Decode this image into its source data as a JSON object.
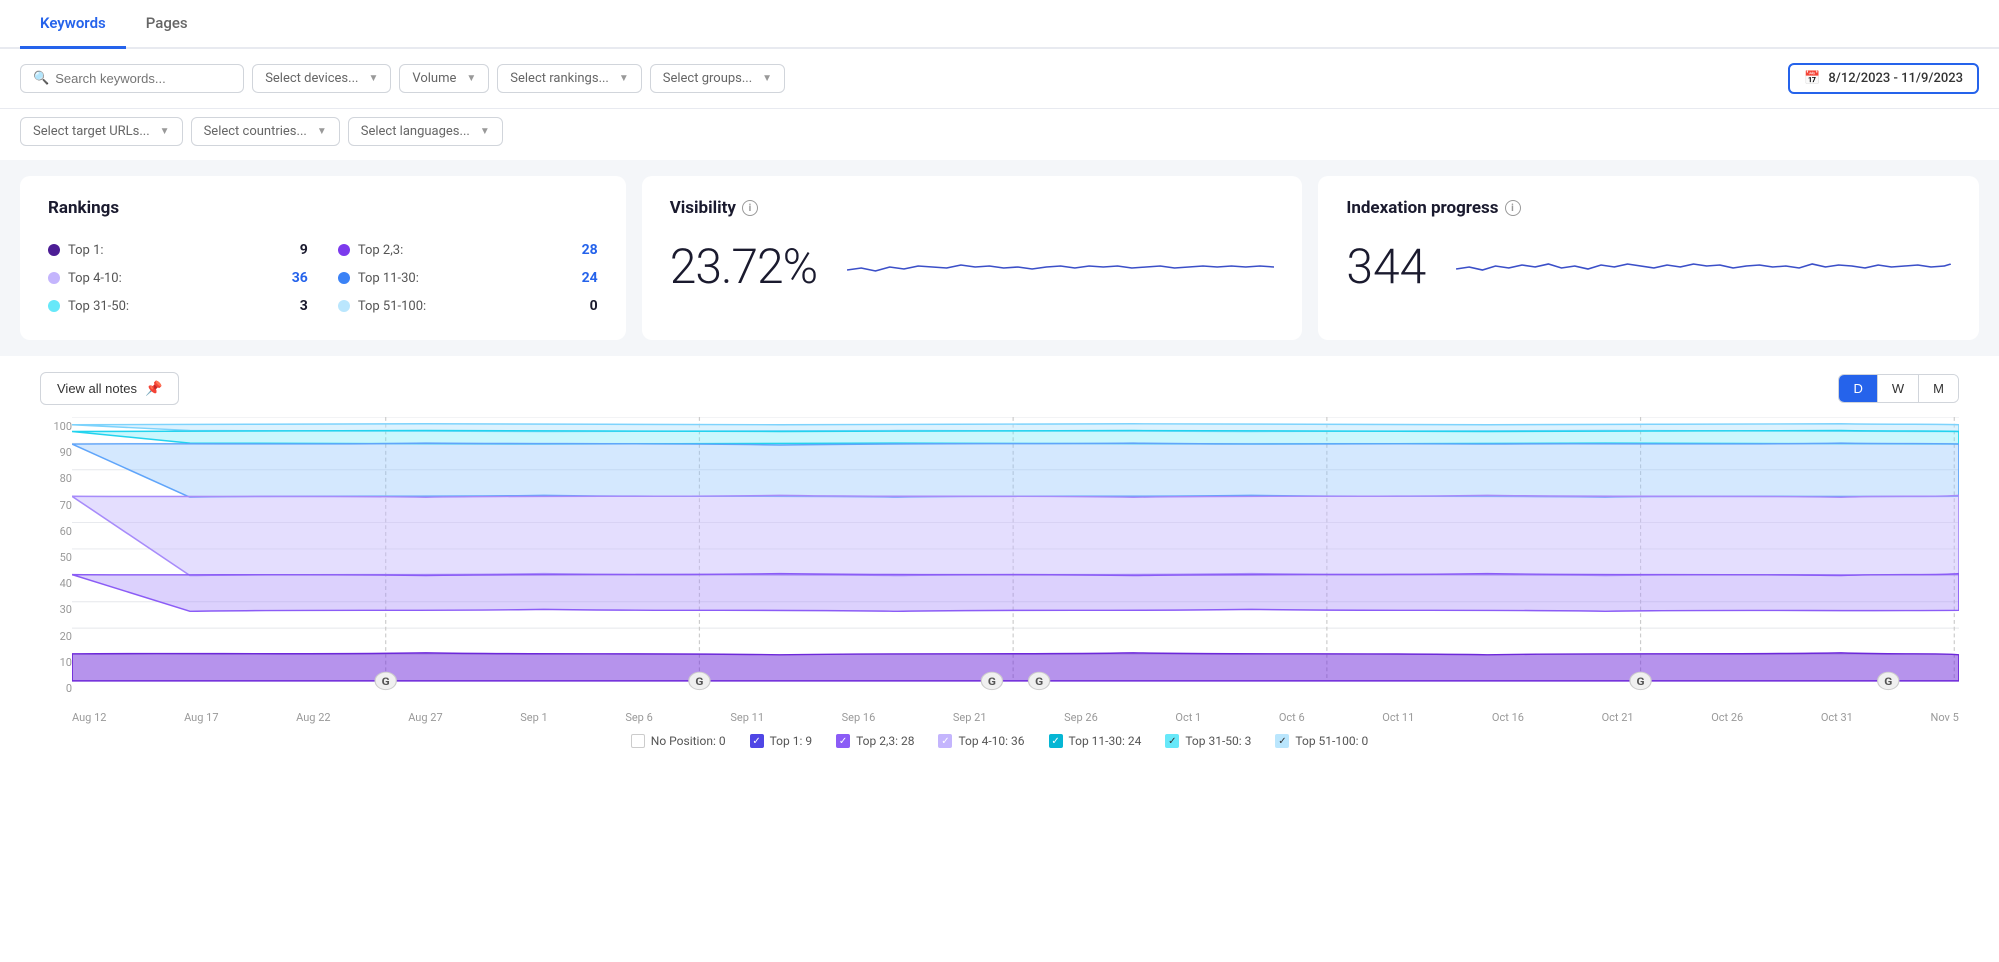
{
  "tabs": [
    {
      "label": "Keywords",
      "active": true
    },
    {
      "label": "Pages",
      "active": false
    }
  ],
  "filters": {
    "search_placeholder": "Search keywords...",
    "devices_placeholder": "Select devices...",
    "volume_placeholder": "Volume",
    "rankings_placeholder": "Select rankings...",
    "groups_placeholder": "Select groups...",
    "date_range": "8/12/2023 - 11/9/2023",
    "target_urls_placeholder": "Select target URLs...",
    "countries_placeholder": "Select countries...",
    "languages_placeholder": "Select languages..."
  },
  "rankings": {
    "title": "Rankings",
    "items": [
      {
        "label": "Top 1:",
        "value": "9",
        "color": "#5b21b6"
      },
      {
        "label": "Top 2,3:",
        "value": "28",
        "color": "#7c3aed"
      },
      {
        "label": "Top 4-10:",
        "value": "36",
        "color": "#c4b5fd"
      },
      {
        "label": "Top 11-30:",
        "value": "24",
        "color": "#3b82f6"
      },
      {
        "label": "Top 31-50:",
        "value": "3",
        "color": "#67e8f9"
      },
      {
        "label": "Top 51-100:",
        "value": "0",
        "color": "#bae6fd"
      }
    ]
  },
  "visibility": {
    "title": "Visibility",
    "value": "23.72%"
  },
  "indexation": {
    "title": "Indexation progress",
    "value": "344"
  },
  "chart": {
    "view_notes_label": "View all notes",
    "period_buttons": [
      "D",
      "W",
      "M"
    ],
    "active_period": "D",
    "y_labels": [
      "100",
      "90",
      "80",
      "70",
      "60",
      "50",
      "40",
      "30",
      "20",
      "10",
      "0"
    ],
    "x_labels": [
      "Aug 12",
      "Aug 17",
      "Aug 22",
      "Aug 27",
      "Sep 1",
      "Sep 6",
      "Sep 11",
      "Sep 16",
      "Sep 21",
      "Sep 26",
      "Oct 1",
      "Oct 6",
      "Oct 11",
      "Oct 16",
      "Oct 21",
      "Oct 26",
      "Oct 31",
      "Nov 5"
    ]
  },
  "legend": [
    {
      "label": "No Position: 0",
      "color": "none",
      "checked": false,
      "border": "#ccc"
    },
    {
      "label": "Top 1: 9",
      "color": "#4f46e5",
      "checked": true
    },
    {
      "label": "Top 2,3: 28",
      "color": "#8b5cf6",
      "checked": true
    },
    {
      "label": "Top 4-10: 36",
      "color": "#c4b5fd",
      "checked": true
    },
    {
      "label": "Top 11-30: 24",
      "color": "#06b6d4",
      "checked": true
    },
    {
      "label": "Top 31-50: 3",
      "color": "#67e8f9",
      "checked": true
    },
    {
      "label": "Top 51-100: 0",
      "color": "#bae6fd",
      "checked": true
    }
  ]
}
